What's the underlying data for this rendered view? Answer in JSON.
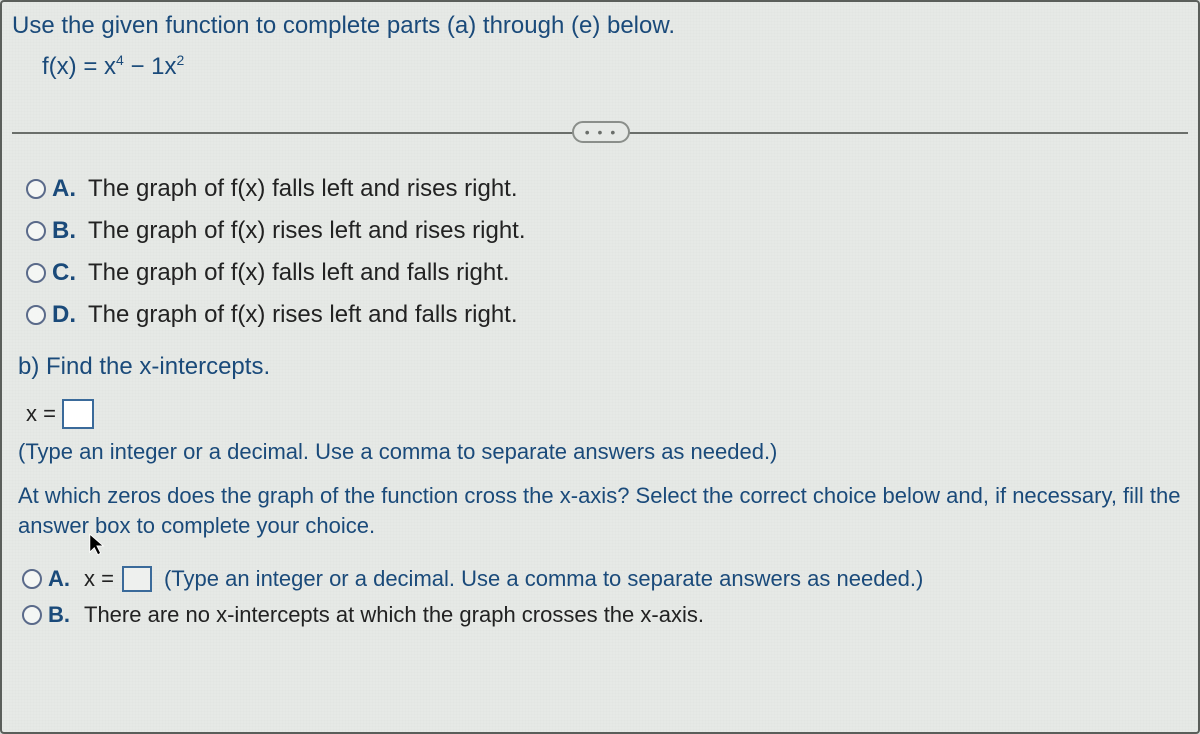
{
  "instruction": "Use the given function to complete parts (a) through (e) below.",
  "formula_prefix": "f(x) = x",
  "formula_exp1": "4",
  "formula_mid": " − 1x",
  "formula_exp2": "2",
  "divider_dots": "• • •",
  "options_a": [
    {
      "label": "A.",
      "text": "The graph of f(x) falls left and rises right."
    },
    {
      "label": "B.",
      "text": "The graph of f(x) rises left and rises right."
    },
    {
      "label": "C.",
      "text": "The graph of f(x) falls left and falls right."
    },
    {
      "label": "D.",
      "text": "The graph of f(x) rises left and falls right."
    }
  ],
  "part_b_title": "b) Find the x-intercepts.",
  "x_equals": "x =",
  "hint1": "(Type an integer or a decimal. Use a comma to separate answers as needed.)",
  "para2": "At which zeros does the graph of the function cross the x-axis? Select the correct choice below and, if necessary, fill the answer box to complete your choice.",
  "options_b": {
    "a_label": "A.",
    "a_prefix": "x =",
    "a_hint": "(Type an integer or a decimal. Use a comma to separate answers as needed.)",
    "b_label": "B.",
    "b_text": "There are no x-intercepts at which the graph crosses the x-axis."
  }
}
